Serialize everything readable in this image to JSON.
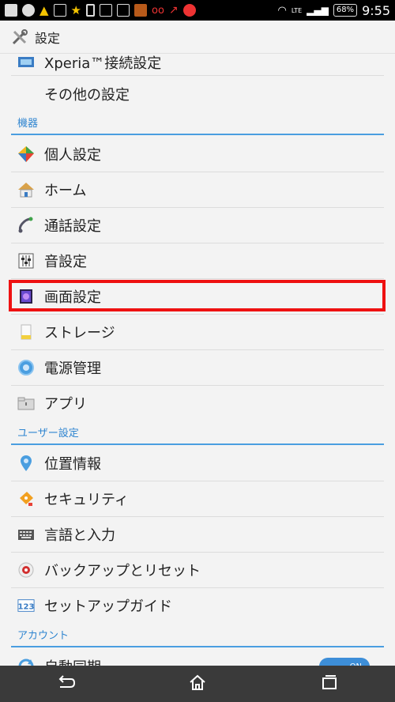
{
  "status": {
    "battery": "68%",
    "time": "9:55",
    "network": "LTE"
  },
  "header": {
    "title": "設定"
  },
  "partial_top_item": {
    "label": "Xperia™接続設定"
  },
  "other_settings": {
    "label": "その他の設定"
  },
  "sections": {
    "devices": "機器",
    "user": "ユーザー設定",
    "account": "アカウント"
  },
  "device_items": [
    {
      "label": "個人設定",
      "icon": "personalize-icon"
    },
    {
      "label": "ホーム",
      "icon": "home-icon"
    },
    {
      "label": "通話設定",
      "icon": "phone-icon"
    },
    {
      "label": "音設定",
      "icon": "sound-icon"
    },
    {
      "label": "画面設定",
      "icon": "display-icon"
    },
    {
      "label": "ストレージ",
      "icon": "storage-icon"
    },
    {
      "label": "電源管理",
      "icon": "power-icon"
    },
    {
      "label": "アプリ",
      "icon": "apps-icon"
    }
  ],
  "user_items": [
    {
      "label": "位置情報",
      "icon": "location-icon"
    },
    {
      "label": "セキュリティ",
      "icon": "security-icon"
    },
    {
      "label": "言語と入力",
      "icon": "keyboard-icon"
    },
    {
      "label": "バックアップとリセット",
      "icon": "backup-icon"
    },
    {
      "label": "セットアップガイド",
      "icon": "setup-guide-icon"
    }
  ],
  "account_items": [
    {
      "label": "自動同期",
      "icon": "sync-icon",
      "toggle": "ON"
    }
  ],
  "colors": {
    "accent": "#2f85d0",
    "highlight": "#ee1111"
  }
}
